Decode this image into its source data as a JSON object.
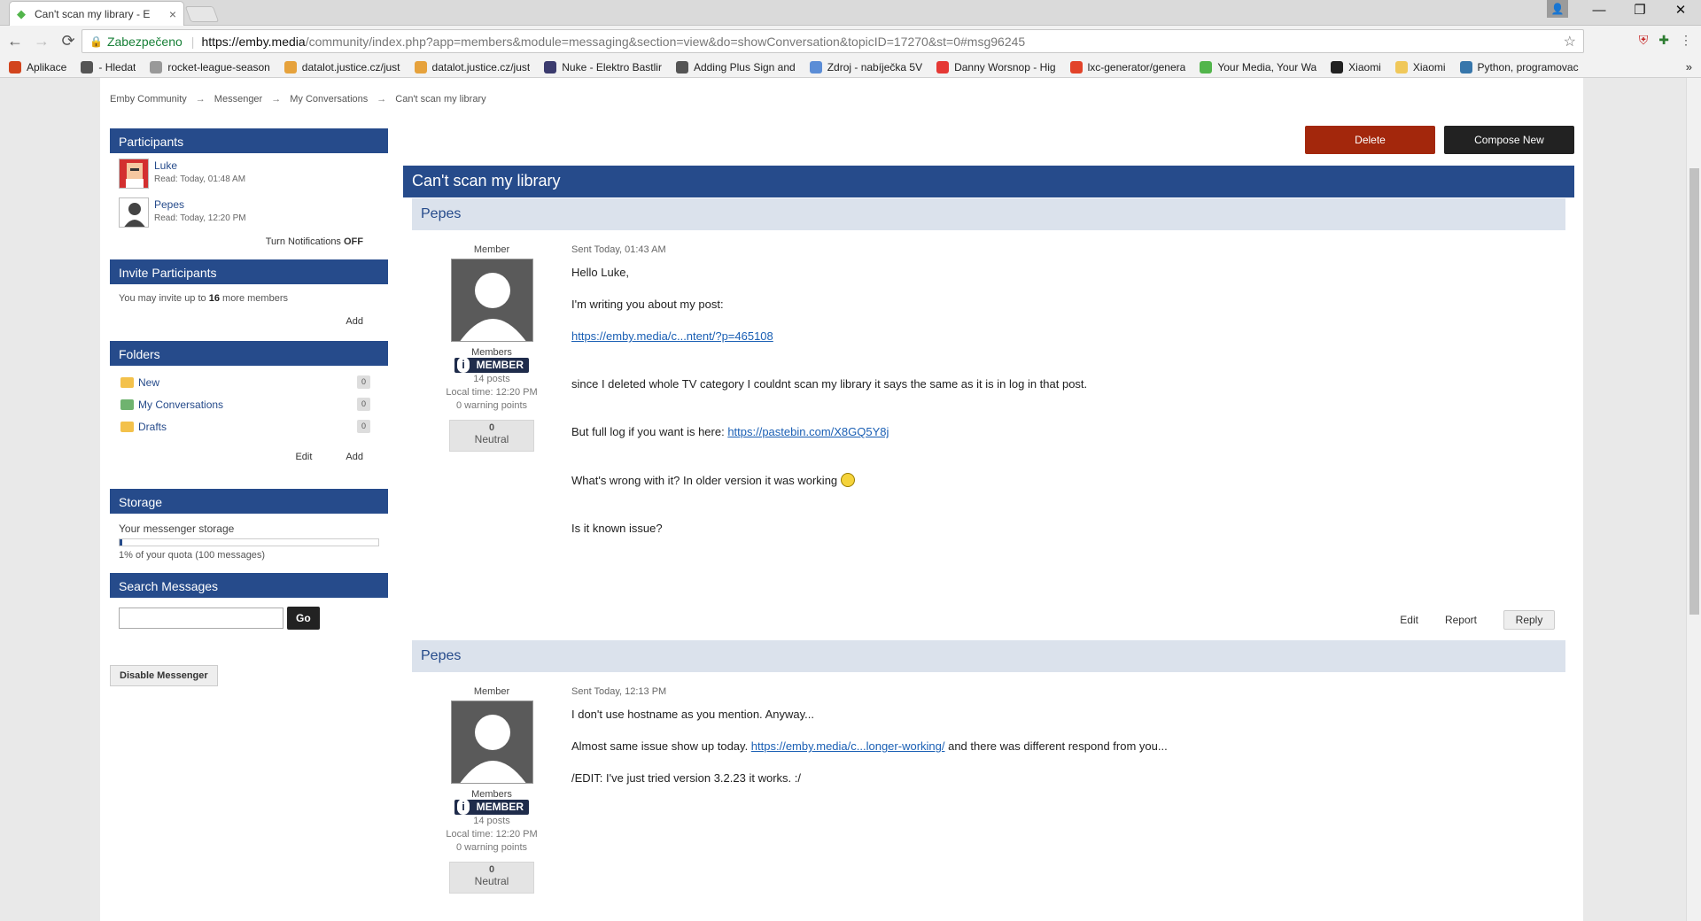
{
  "browser": {
    "tab_title": "Can't scan my library - E",
    "tab_close": "×",
    "window_controls": [
      "—",
      "❐",
      "✕"
    ],
    "user_badge": "👤",
    "nav": {
      "back": "←",
      "forward": "→",
      "reload": "⟳"
    },
    "security_label": "Zabezpečeno",
    "url_host": "https://emby.media",
    "url_path": "/community/index.php?app=members&module=messaging&section=view&do=showConversation&topicID=17270&st=0#msg96245",
    "star": "☆",
    "extensions": [
      "⛨",
      "✚",
      "⋮"
    ],
    "bookmarks": [
      {
        "label": "Aplikace",
        "icon": "apps-icon",
        "color": "#d2451e"
      },
      {
        "label": "- Hledat",
        "icon": "grid-icon",
        "color": "#555555"
      },
      {
        "label": "rocket-league-season",
        "icon": "page-icon",
        "color": "#999999"
      },
      {
        "label": "datalot.justice.cz/just",
        "icon": "justice-icon",
        "color": "#e6a23c"
      },
      {
        "label": "datalot.justice.cz/just",
        "icon": "justice-icon",
        "color": "#e6a23c"
      },
      {
        "label": "Nuke - Elektro Bastlir",
        "icon": "nuke-icon",
        "color": "#3b3b6e"
      },
      {
        "label": "Adding Plus Sign and",
        "icon": "diamond-icon",
        "color": "#555555"
      },
      {
        "label": "Zdroj - nabíječka 5V",
        "icon": "ve-icon",
        "color": "#5b8dd6"
      },
      {
        "label": "Danny Worsnop - Hig",
        "icon": "youtube-icon",
        "color": "#e53935"
      },
      {
        "label": "lxc-generator/genera",
        "icon": "gitlab-icon",
        "color": "#e24329"
      },
      {
        "label": "Your Media, Your Wa",
        "icon": "emby-icon",
        "color": "#52b54b"
      },
      {
        "label": "Xiaomi",
        "icon": "github-icon",
        "color": "#222222"
      },
      {
        "label": "Xiaomi",
        "icon": "folder-icon",
        "color": "#f0c85a"
      },
      {
        "label": "Python, programovac",
        "icon": "python-icon",
        "color": "#3776ab"
      }
    ],
    "more": "»"
  },
  "breadcrumb": [
    "Emby Community",
    "Messenger",
    "My Conversations",
    "Can't scan my library"
  ],
  "breadcrumb_sep": "→",
  "sidebar": {
    "participants_title": "Participants",
    "participants": [
      {
        "name": "Luke",
        "read": "Read: Today, 01:48 AM"
      },
      {
        "name": "Pepes",
        "read": "Read: Today, 12:20 PM"
      }
    ],
    "notif_prefix": "Turn Notifications",
    "notif_state": "OFF",
    "invite_title": "Invite Participants",
    "invite_prefix": "You may invite up to",
    "invite_count": "16",
    "invite_suffix": "more members",
    "invite_add": "Add",
    "folders_title": "Folders",
    "folders": [
      {
        "name": "New",
        "count": "0",
        "color": "#f3c14b"
      },
      {
        "name": "My Conversations",
        "count": "0",
        "color": "#6fb36f"
      },
      {
        "name": "Drafts",
        "count": "0",
        "color": "#f3c14b"
      }
    ],
    "folders_edit": "Edit",
    "folders_add": "Add",
    "storage_title": "Storage",
    "storage_label": "Your messenger storage",
    "storage_fraction": 0.01,
    "storage_quota": "1% of your quota (100 messages)",
    "search_title": "Search Messages",
    "search_go": "Go",
    "disable_btn": "Disable Messenger"
  },
  "actions": {
    "delete": "Delete",
    "compose": "Compose New"
  },
  "conversation_title": "Can't scan my library",
  "posts": [
    {
      "author": "Pepes",
      "role": "Member",
      "group": "Members",
      "badge": "MEMBER",
      "posts": "14 posts",
      "local_time": "Local time: 12:20 PM",
      "warnings": "0 warning points",
      "rep_num": "0",
      "rep_label": "Neutral",
      "sent": "Sent Today, 01:43 AM",
      "lines": {
        "l1": "Hello Luke,",
        "l2": "I'm writing you about my post:",
        "link1": "https://emby.media/c...ntent/?p=465108",
        "l3": "since I deleted whole TV category I couldnt scan my library it says the same as it is in log in that post.",
        "l4": "But full log if you want is here: ",
        "link2": "https://pastebin.com/X8GQ5Y8j",
        "l5": "What's wrong with it? In older version it was working",
        "l6": "Is it known issue?"
      },
      "edit": "Edit",
      "report": "Report",
      "reply": "Reply"
    },
    {
      "author": "Pepes",
      "role": "Member",
      "group": "Members",
      "badge": "MEMBER",
      "posts": "14 posts",
      "local_time": "Local time: 12:20 PM",
      "warnings": "0 warning points",
      "rep_num": "0",
      "rep_label": "Neutral",
      "sent": "Sent Today, 12:13 PM",
      "lines": {
        "l1": "I don't use hostname as you mention. Anyway...",
        "l2": "Almost same issue show up today. ",
        "link1": "https://emby.media/c...longer-working/",
        "l2b": " and there was different respond from you...",
        "l3": "/EDIT: I've just tried version 3.2.23 it works. :/"
      }
    }
  ]
}
